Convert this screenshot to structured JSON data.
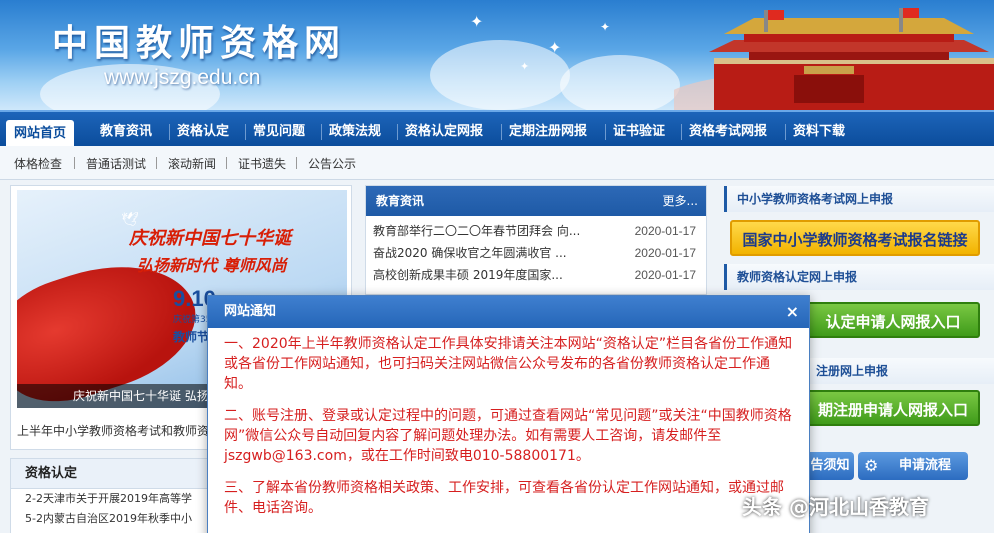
{
  "header": {
    "title": "中国教师资格网",
    "url": "www.jszg.edu.cn"
  },
  "main_nav": [
    {
      "label": "网站首页"
    },
    {
      "label": "教育资讯"
    },
    {
      "label": "资格认定"
    },
    {
      "label": "常见问题"
    },
    {
      "label": "政策法规"
    },
    {
      "label": "资格认定网报"
    },
    {
      "label": "定期注册网报"
    },
    {
      "label": "证书验证"
    },
    {
      "label": "资格考试网报"
    },
    {
      "label": "资料下载"
    }
  ],
  "sub_nav": [
    {
      "label": "体格检查"
    },
    {
      "label": "普通话测试"
    },
    {
      "label": "滚动新闻"
    },
    {
      "label": "证书遗失"
    },
    {
      "label": "公告公示"
    }
  ],
  "slide": {
    "headline1": "庆祝新中国七十华诞",
    "headline2": "弘扬新时代 尊师风尚",
    "date": "9.10",
    "small_text": "庆祝第35个",
    "holiday": "教师节",
    "caption": "庆祝新中国七十华诞 弘扬新时代尊师风尚",
    "marquee": "上半年中小学教师资格考试和教师资格"
  },
  "left_news": {
    "title": "资格认定",
    "items": [
      {
        "text": "2-2天津市关于开展2019年高等学"
      },
      {
        "text": "5-2内蒙古自治区2019年秋季中小"
      }
    ]
  },
  "center_news": {
    "title": "教育资讯",
    "more": "更多...",
    "items": [
      {
        "title": "教育部举行二〇二〇年春节团拜会 向...",
        "date": "2020-01-17"
      },
      {
        "title": "奋战2020 确保收官之年圆满收官 ...",
        "date": "2020-01-17"
      },
      {
        "title": "高校创新成果丰硕 2019年度国家...",
        "date": "2020-01-17"
      }
    ]
  },
  "right": {
    "section1_title": "中小学教师资格考试网上申报",
    "section1_button": "国家中小学教师资格考试报名链接",
    "section2_title": "教师资格认定网上申报",
    "section2_button": "认定申请人网报入口",
    "section3_title": "注册网上申报",
    "section3_button": "期注册申请人网报入口",
    "small_buttons": [
      {
        "label": "告须知"
      },
      {
        "label": "申请流程"
      }
    ]
  },
  "modal": {
    "title": "网站通知",
    "close": "×",
    "paragraphs": [
      "一、2020年上半年教师资格认定工作具体安排请关注本网站“资格认定”栏目各省份工作通知或各省份工作网站通知，也可扫码关注网站微信公众号发布的各省份教师资格认定工作通知。",
      "二、账号注册、登录或认定过程中的问题，可通过查看网站“常见问题”或关注“中国教师资格网”微信公众号自动回复内容了解问题处理办法。如有需要人工咨询，请发邮件至jszgwb@163.com，或在工作时间致电010-58800171。",
      "三、了解本省份教师资格相关政策、工作安排，可查看各省份认定工作网站通知，或通过邮件、电话咨询。"
    ]
  },
  "watermark": "头条 @河北山香教育",
  "colors": {
    "nav": "#0b4d9c",
    "modal_text": "#d61f1f",
    "yellow_button": "#f2b300",
    "green_button": "#3f9b1a"
  }
}
